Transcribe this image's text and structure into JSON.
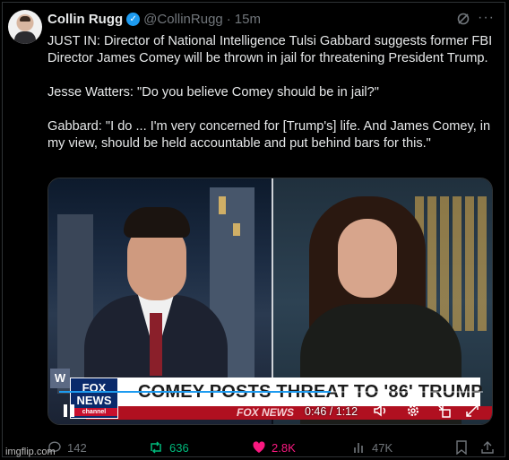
{
  "tweet": {
    "author_name": "Collin Rugg",
    "handle": "@CollinRugg",
    "separator": "·",
    "time": "15m",
    "paragraphs": [
      "JUST IN: Director of National Intelligence Tulsi Gabbard suggests former FBI Director James Comey will be thrown in jail for threatening President Trump.",
      "Jesse Watters: \"Do you believe Comey should be in jail?\"",
      "Gabbard: \"I do ... I'm very concerned for [Trump's] life. And James Comey, in my view, should be held accountable and put behind bars for this.\""
    ],
    "verified_icon": "verified-badge-icon",
    "more_icon": "more-dots-icon",
    "grok_icon": "grok-icon"
  },
  "video": {
    "chyron": "COMEY POSTS THREAT TO '86' TRUMP",
    "ticker": "FOX NEWS",
    "logo_line1": "FOX",
    "logo_line2": "NEWS",
    "logo_line3": "channel",
    "corner_mark": "W",
    "time_display": "0:46 / 1:12",
    "progress": 0.64,
    "controls": [
      "pause-icon",
      "volume-icon",
      "settings-icon",
      "exit-fullscreen-icon",
      "fullscreen-icon"
    ]
  },
  "actions": {
    "replies": "142",
    "reposts": "636",
    "likes": "2.8K",
    "views": "47K",
    "colors": {
      "repost": "#00ba7c",
      "like": "#f91880",
      "muted": "#71767b"
    }
  },
  "watermark": "imgflip.com"
}
